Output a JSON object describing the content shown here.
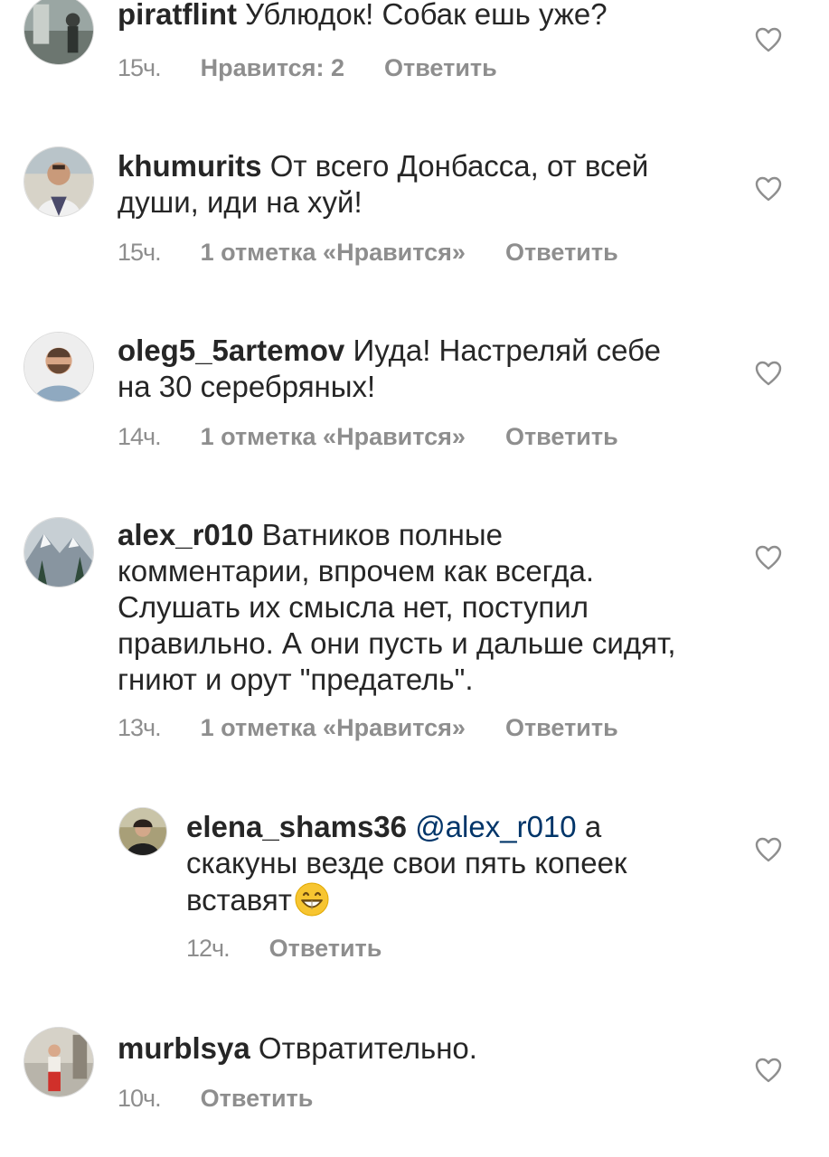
{
  "comments": [
    {
      "username": "piratflint",
      "text": "Ублюдок! Собак ешь уже?",
      "time": "15ч.",
      "likes": "Нравится: 2",
      "reply": "Ответить"
    },
    {
      "username": "khumurits",
      "text": "От всего Донбасса, от всей души, иди на хуй!",
      "time": "15ч.",
      "likes": "1 отметка «Нравится»",
      "reply": "Ответить"
    },
    {
      "username": "oleg5_5artemov",
      "text": "Иуда! Настреляй себе на 30 серебряных!",
      "time": "14ч.",
      "likes": "1 отметка «Нравится»",
      "reply": "Ответить"
    },
    {
      "username": "alex_r010",
      "text": "Ватников полные комментарии, впрочем как всегда. Слушать их смысла нет, поступил правильно. А они пусть и дальше сидят, гниют и орут \"предатель\".",
      "time": "13ч.",
      "likes": "1 отметка «Нравится»",
      "reply": "Ответить"
    },
    {
      "username": "elena_shams36",
      "mention": "@alex_r010",
      "text": "а скакуны везде свои пять копеек вставят",
      "time": "12ч.",
      "reply": "Ответить"
    },
    {
      "username": "murblsya",
      "text": "Отвратительно.",
      "time": "10ч.",
      "reply": "Ответить"
    }
  ],
  "icons": {
    "like": "heart-outline-icon",
    "emoji": "grinning-face-emoji"
  },
  "colors": {
    "text": "#262626",
    "meta": "#8e8e8e",
    "mention": "#003569",
    "icon": "#8e8e8e"
  }
}
